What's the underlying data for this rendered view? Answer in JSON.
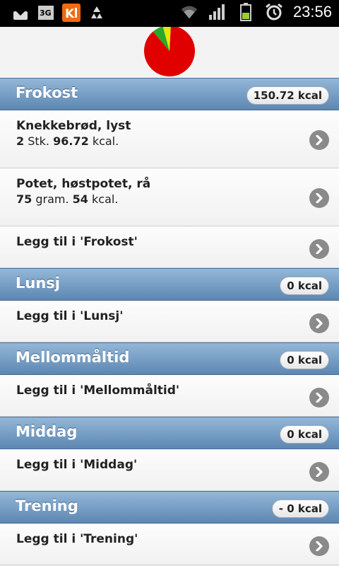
{
  "status_bar": {
    "time": "23:56",
    "left_icons": [
      "download-icon",
      "3g-icon",
      "kalo-app-icon",
      "recycle-icon"
    ],
    "right_icons": [
      "wifi-icon",
      "signal-icon",
      "battery-icon",
      "alarm-icon"
    ]
  },
  "chart_data": {
    "type": "pie",
    "values": [
      88,
      7,
      5
    ],
    "colors": [
      "#e00000",
      "#2aa82a",
      "#e8e800"
    ]
  },
  "sections": [
    {
      "title": "Frokost",
      "kcal": "150.72 kcal",
      "items": [
        {
          "name": "Knekkebrød, lyst",
          "qty": "2",
          "unit": "Stk.",
          "kcal": "96.72",
          "kcal_unit": "kcal."
        },
        {
          "name": "Potet, høstpotet, rå",
          "qty": "75",
          "unit": "gram.",
          "kcal": "54",
          "kcal_unit": "kcal."
        }
      ],
      "add_label": "Legg til i 'Frokost'"
    },
    {
      "title": "Lunsj",
      "kcal": "0 kcal",
      "items": [],
      "add_label": "Legg til i 'Lunsj'"
    },
    {
      "title": "Mellommåltid",
      "kcal": "0 kcal",
      "items": [],
      "add_label": "Legg til i 'Mellommåltid'"
    },
    {
      "title": "Middag",
      "kcal": "0 kcal",
      "items": [],
      "add_label": "Legg til i 'Middag'"
    },
    {
      "title": "Trening",
      "kcal": "- 0 kcal",
      "items": [],
      "add_label": "Legg til i 'Trening'"
    }
  ]
}
